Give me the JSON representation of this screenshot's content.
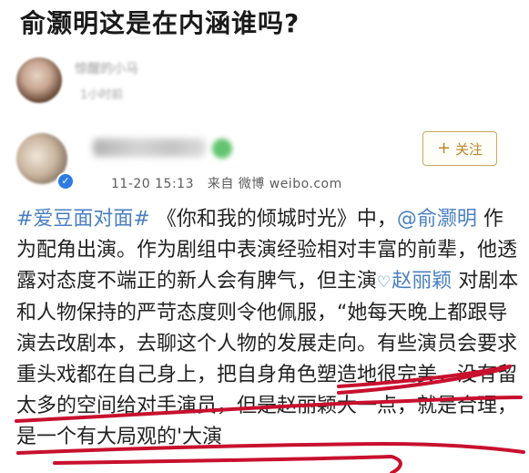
{
  "headline": "俞灏明这是在内涵谁吗?",
  "author": {
    "name": "惊醒的小马",
    "time": "1小时前"
  },
  "weibo": {
    "verified_mark": "✓",
    "post_time": "11-20 15:13",
    "source_label": "来自 微博 weibo.com",
    "follow_plus": "+",
    "follow_label": "关注",
    "topic": "#爱豆面对面#",
    "line1_after_topic": " 《你和我的倾城时光》中，",
    "mention1": "@俞灏明",
    "line2_rest": " 作为配角出演。作为剧组中表演经验相对丰富的前辈，他透露对态度不端正的新人会有脾气，但主演",
    "mention2_icon": "♡",
    "mention2": "赵丽颖",
    "line4_rest": " 对剧本和人物保持的严苛态度则令他佩服，“她每天晚上都跟导演去改剧本，去聊这个人物的发展走向。有些演员会要求重头戏都在自己身上，把自身角色塑造地很完美，没有留太多的空间给对手演员，但是赵丽颖大一点，就是合理，是一个有大局观的'大演"
  },
  "colors": {
    "link": "#4a7fc2",
    "follow": "#b8862d",
    "ink": "#c8102e",
    "verified": "#2a7be2"
  },
  "icons": {
    "verify": "verified-badge-icon",
    "vip": "vip-level-icon",
    "plus": "plus-icon",
    "mention": "super-topic-icon"
  }
}
